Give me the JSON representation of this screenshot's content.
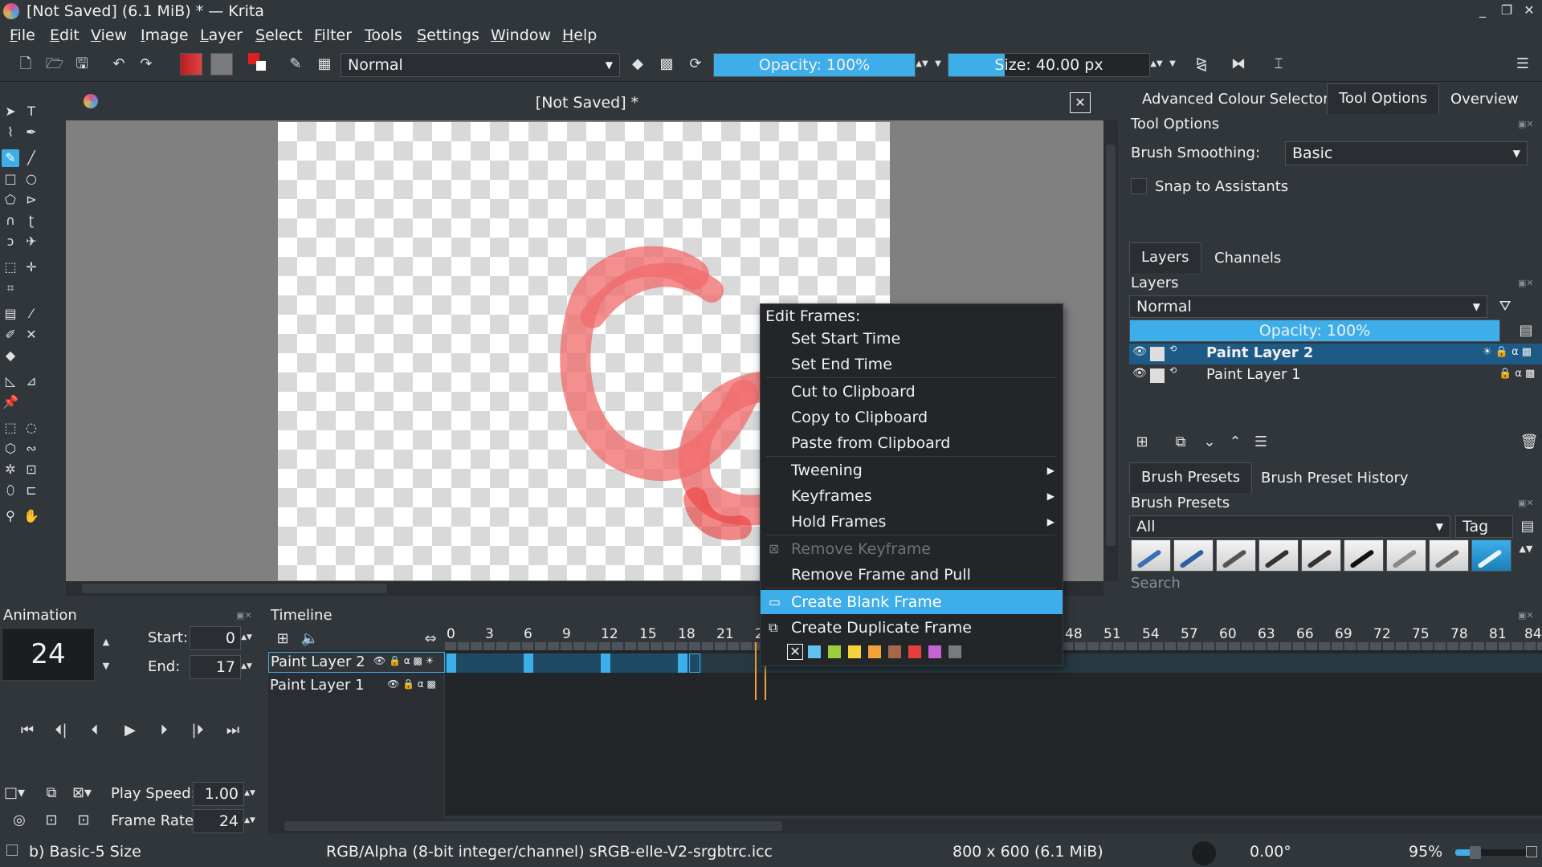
{
  "window": {
    "title": "[Not Saved] (6.1 MiB) * — Krita",
    "minimize": "_",
    "maximize": "❐",
    "close": "✕"
  },
  "menu": [
    "File",
    "Edit",
    "View",
    "Image",
    "Layer",
    "Select",
    "Filter",
    "Tools",
    "Settings",
    "Window",
    "Help"
  ],
  "toolbar": {
    "blend_mode": "Normal",
    "opacity": "Opacity: 100%",
    "opacity_value": 1.0,
    "size": "Size: 40.00 px",
    "size_fraction": 0.1
  },
  "document": {
    "tab_title": "[Not Saved]  *",
    "close": "✕"
  },
  "right_dock": {
    "tabs_top": [
      "Advanced Colour Selector",
      "Tool Options",
      "Overview"
    ],
    "tool_options_header": "Tool Options",
    "brush_smoothing_label": "Brush Smoothing:",
    "brush_smoothing_value": "Basic",
    "snap_label": "Snap to Assistants",
    "layers_tabs": [
      "Layers",
      "Channels"
    ],
    "layers_header": "Layers",
    "layers_blend": "Normal",
    "layers_opacity": "Opacity:  100%",
    "layers": [
      {
        "name": "Paint Layer 2",
        "selected": true
      },
      {
        "name": "Paint Layer 1",
        "selected": false
      }
    ],
    "brush_tabs": [
      "Brush Presets",
      "Brush Preset History"
    ],
    "brush_header": "Brush Presets",
    "brush_filter": "All",
    "tag_label": "Tag",
    "search_placeholder": "Search"
  },
  "animation": {
    "header": "Animation",
    "current_frame": "24",
    "start_label": "Start:",
    "start_value": "0",
    "end_label": "End:",
    "end_value": "17",
    "play_speed_label": "Play Speed:",
    "play_speed_value": "1.00",
    "frame_rate_label": "Frame Rate:",
    "frame_rate_value": "24"
  },
  "timeline": {
    "header": "Timeline",
    "frame_numbers": [
      "0",
      "3",
      "6",
      "9",
      "12",
      "15",
      "18",
      "21",
      "2",
      "",
      "",
      "",
      "",
      "48",
      "51",
      "54",
      "57",
      "60",
      "63",
      "66",
      "69",
      "72",
      "75",
      "78",
      "81",
      "84"
    ],
    "layers": [
      "Paint Layer 2",
      "Paint Layer 1"
    ]
  },
  "context_menu": {
    "title": "Edit Frames:",
    "items": [
      {
        "label": "Set Start Time"
      },
      {
        "label": "Set End Time"
      },
      {
        "label": "Cut to Clipboard"
      },
      {
        "label": "Copy to Clipboard"
      },
      {
        "label": "Paste from Clipboard"
      },
      {
        "label": "Tweening"
      },
      {
        "label": "Keyframes"
      },
      {
        "label": "Hold Frames"
      },
      {
        "label": "Remove Keyframe"
      },
      {
        "label": "Remove Frame and Pull"
      },
      {
        "label": "Create Blank Frame"
      },
      {
        "label": "Create Duplicate Frame"
      }
    ],
    "swatch_colors": [
      "#5fc2f0",
      "#9ccc3a",
      "#f5d33b",
      "#f2a23a",
      "#a9674a",
      "#e83e3e",
      "#c463d6",
      "#7a7a7a"
    ]
  },
  "status": {
    "brush": "b) Basic-5 Size",
    "color_model": "RGB/Alpha (8-bit integer/channel)  sRGB-elle-V2-srgbtrc.icc",
    "dimensions": "800 x 600 (6.1 MiB)",
    "rotation": "0.00°",
    "zoom": "95%"
  },
  "colors": {
    "accent": "#3daee9",
    "stroke": "#f06a6a"
  }
}
